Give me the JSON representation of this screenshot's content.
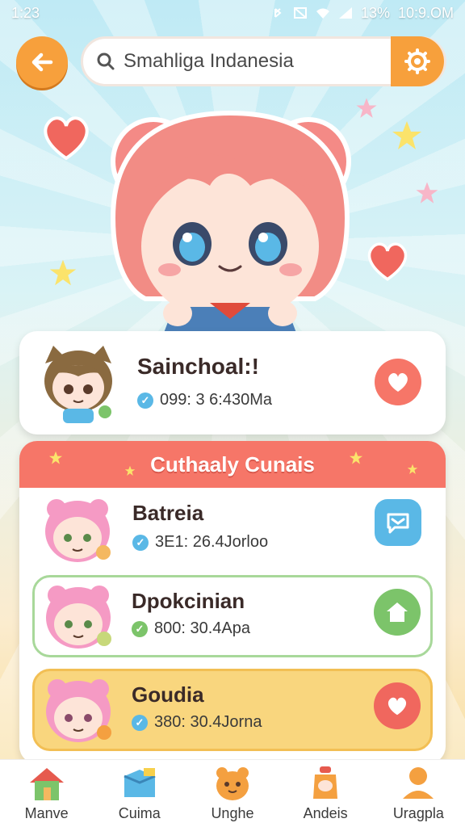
{
  "status_bar": {
    "time": "1:23",
    "battery": "13%",
    "clock": "10:9.OM"
  },
  "search": {
    "text": "Smahliga Indanesia"
  },
  "featured": {
    "name": "Sainchoal:!",
    "sub": "099: 3 6:430Ma"
  },
  "list": {
    "title": "Cuthaaly Cunais",
    "items": [
      {
        "name": "Batreia",
        "sub": "3E1: 26.4Jorloo",
        "action_icon": "chat-icon"
      },
      {
        "name": "Dpokcinian",
        "sub": "800: 30.4Apa",
        "action_icon": "home-icon"
      },
      {
        "name": "Goudia",
        "sub": "380: 30.4Jorna",
        "action_icon": "heart-icon"
      }
    ]
  },
  "nav": [
    {
      "label": "Manve",
      "icon": "house-icon"
    },
    {
      "label": "Cuima",
      "icon": "box-icon"
    },
    {
      "label": "Unghe",
      "icon": "cookie-icon"
    },
    {
      "label": "Andeis",
      "icon": "jar-icon"
    },
    {
      "label": "Uragpla",
      "icon": "person-icon"
    }
  ],
  "colors": {
    "accent_orange": "#f7a03c",
    "header_red": "#f67668",
    "heart_red": "#f0675e",
    "chat_blue": "#5ab8e6",
    "home_green": "#7cc46a"
  }
}
